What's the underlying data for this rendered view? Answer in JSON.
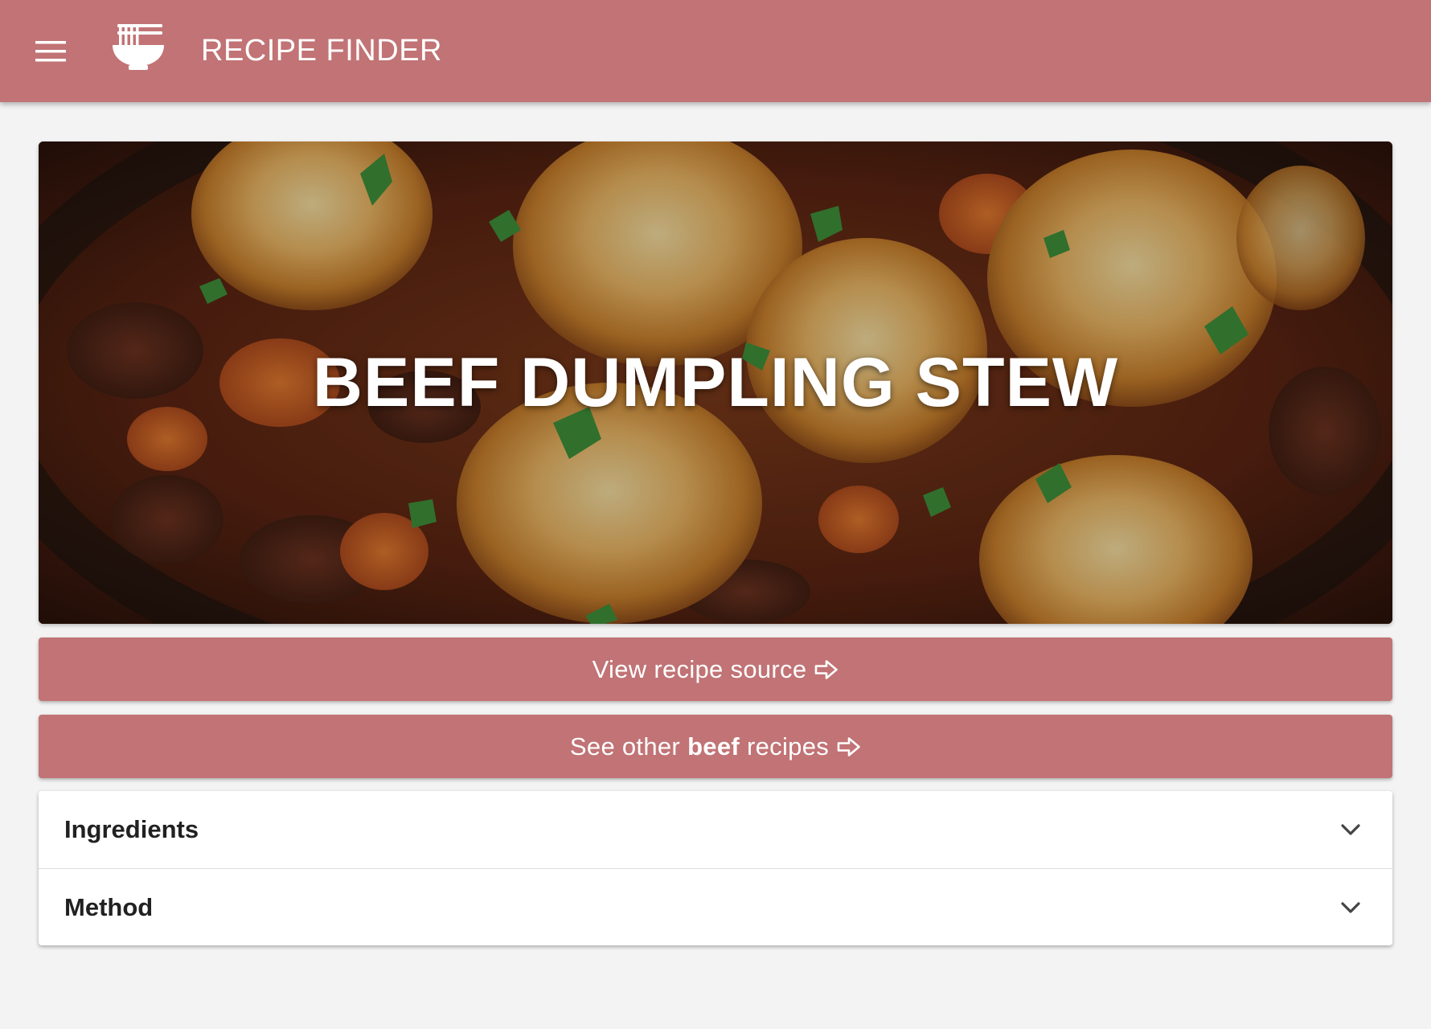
{
  "app_bar": {
    "title": "RECIPE FINDER",
    "menu_icon": "hamburger-menu-icon",
    "logo_icon": "noodle-bowl-icon",
    "background_color": "#c17375"
  },
  "hero": {
    "title": "BEEF DUMPLING STEW",
    "image_description_icon": "recipe-photo"
  },
  "buttons": {
    "source": {
      "label": "View recipe source",
      "icon": "arrow-right-icon"
    },
    "other": {
      "prefix": "See other",
      "category": "beef",
      "suffix": "recipes",
      "icon": "arrow-right-icon"
    }
  },
  "accordion": {
    "items": [
      {
        "label": "Ingredients",
        "icon": "chevron-down-icon"
      },
      {
        "label": "Method",
        "icon": "chevron-down-icon"
      }
    ]
  },
  "colors": {
    "accent": "#c17375",
    "page_background": "#f3f3f3",
    "card_background": "#ffffff"
  }
}
